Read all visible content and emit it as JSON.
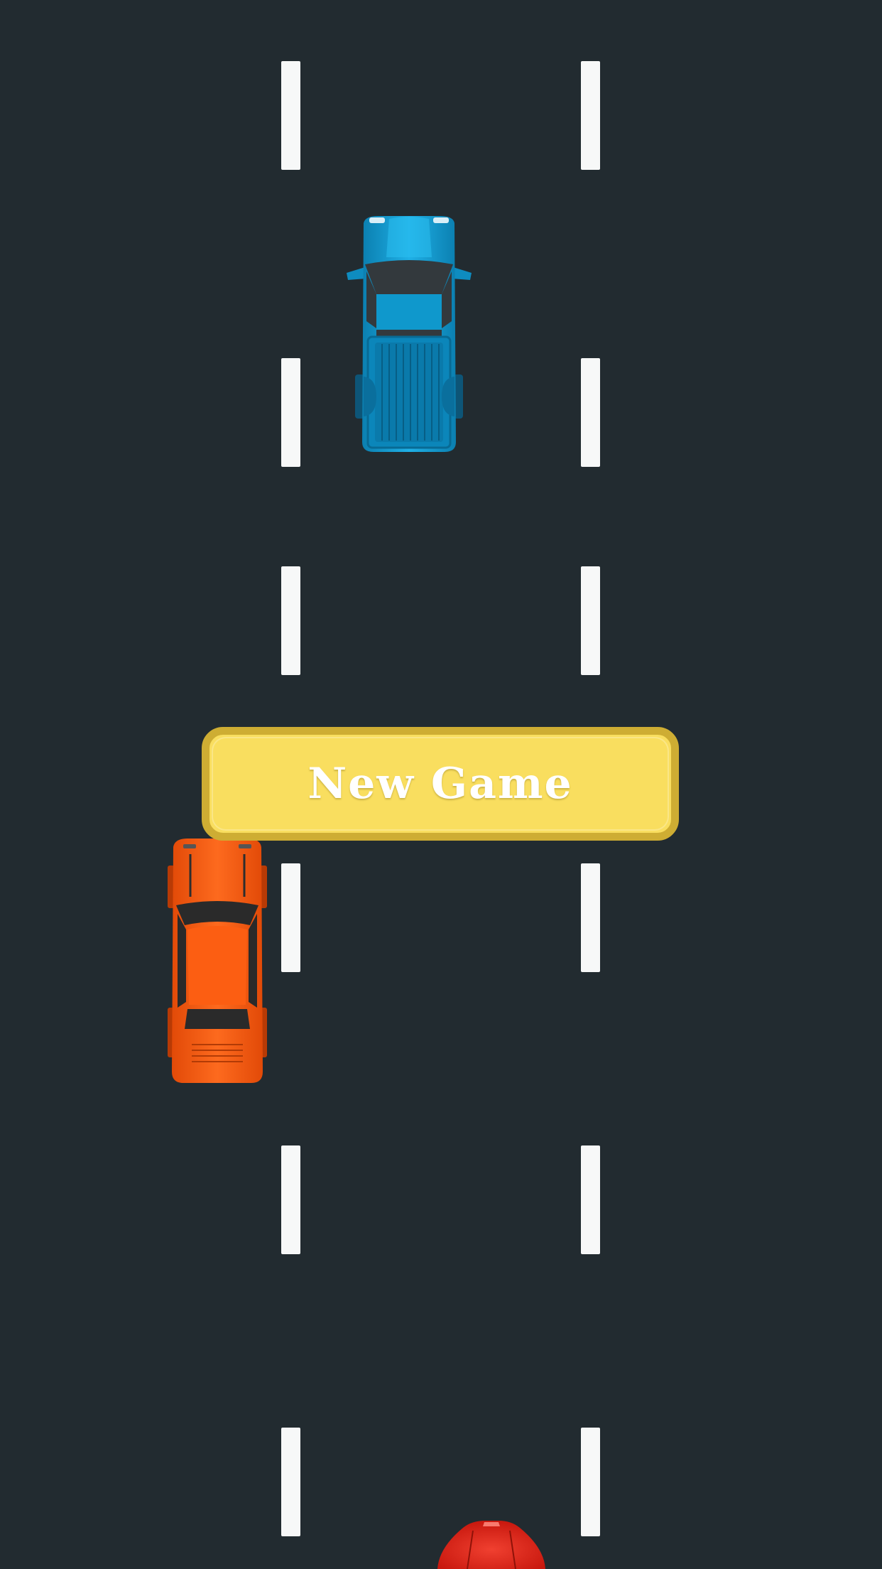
{
  "game": {
    "road_color": "#222b30",
    "lane_marking_color": "#f7f8f8",
    "new_game_button": {
      "label": "New Game",
      "fill_color": "#f9de5f",
      "border_color": "#cead33"
    },
    "vehicles": [
      {
        "name": "blue-pickup-truck",
        "color": "#1aa3d6"
      },
      {
        "name": "orange-sports-car",
        "color": "#fb5a10"
      },
      {
        "name": "red-player-car",
        "color": "#e0281a"
      }
    ]
  }
}
